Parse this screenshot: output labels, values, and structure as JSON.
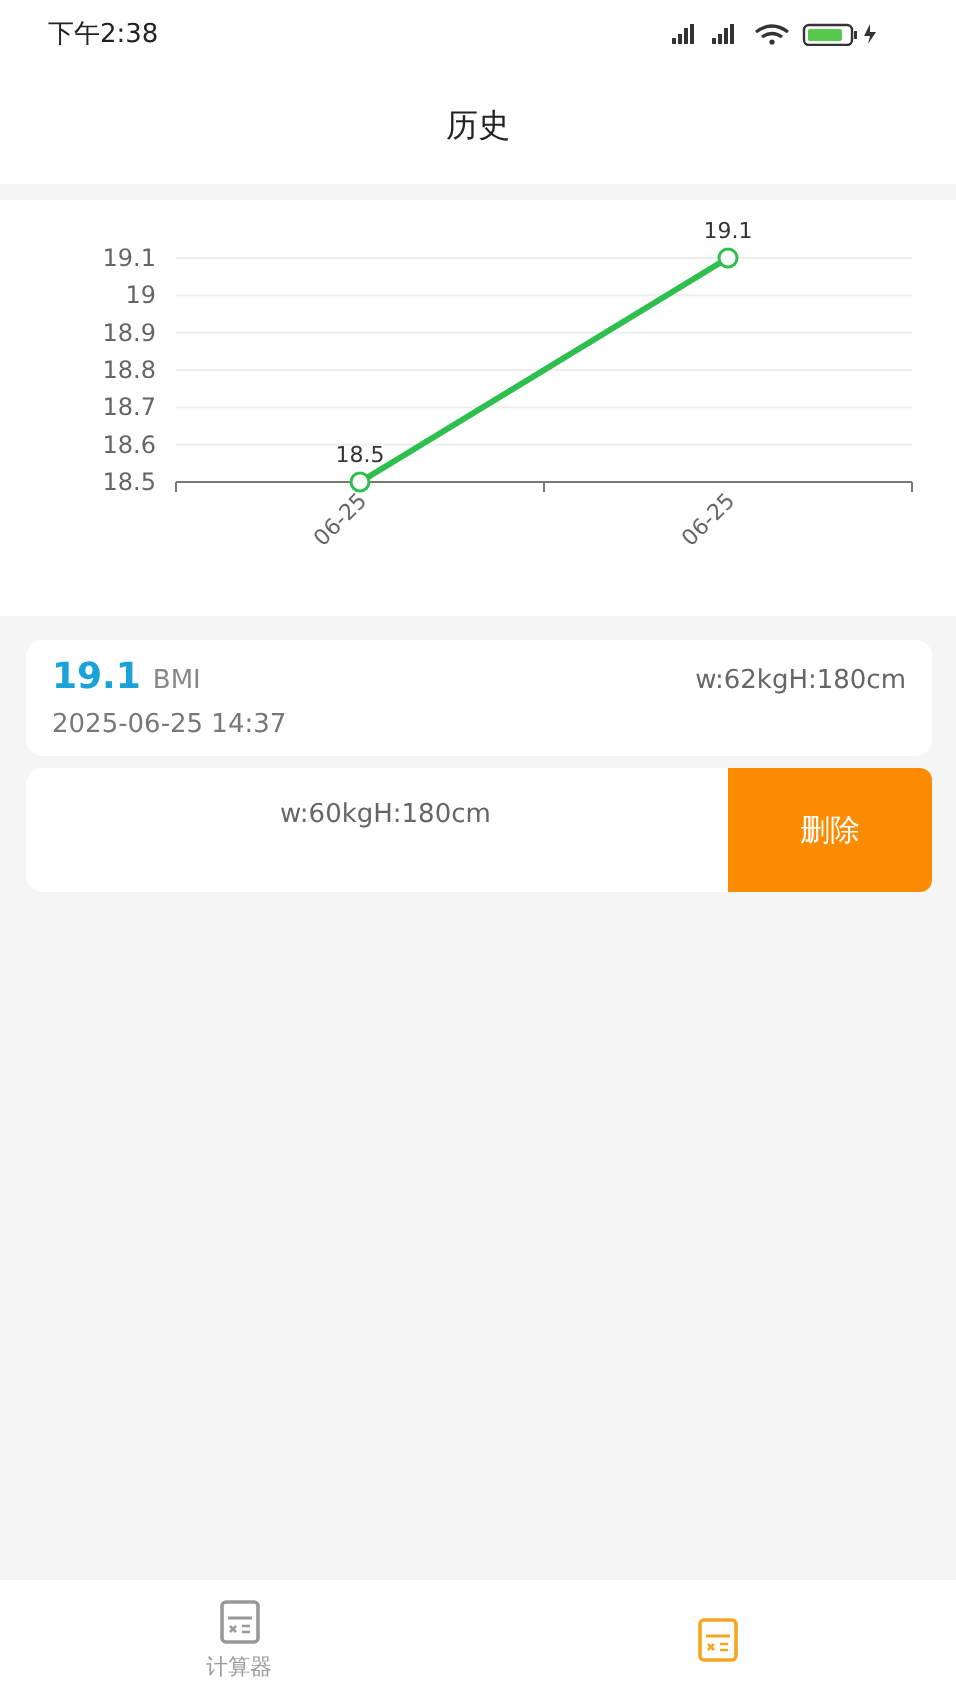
{
  "status_bar": {
    "time": "下午2:38"
  },
  "header": {
    "title": "历史"
  },
  "chart": {
    "chart_data": {
      "type": "line",
      "categories": [
        "06-25",
        "06-25"
      ],
      "series": [
        {
          "color": "#2fbf4f",
          "marker": true,
          "values": [
            18.5,
            19.1
          ]
        }
      ],
      "grid": true,
      "ylim": [
        18.5,
        19.1
      ],
      "yticks": [
        18.5,
        18.6,
        18.7,
        18.8,
        18.9,
        {
          "value": 19,
          "label": "19"
        },
        19.1
      ],
      "data_labels": true
    }
  },
  "records": [
    {
      "kind": "full",
      "bmi": "19.1",
      "unit": "BMI",
      "measures": "w:62kgH:180cm",
      "time": "2025-06-25 14:37"
    },
    {
      "kind": "swiped",
      "measures": "w:60kgH:180cm",
      "action": "删除"
    }
  ],
  "tabs": [
    {
      "label": "计算器",
      "selected": false
    },
    {
      "selected": true
    }
  ]
}
